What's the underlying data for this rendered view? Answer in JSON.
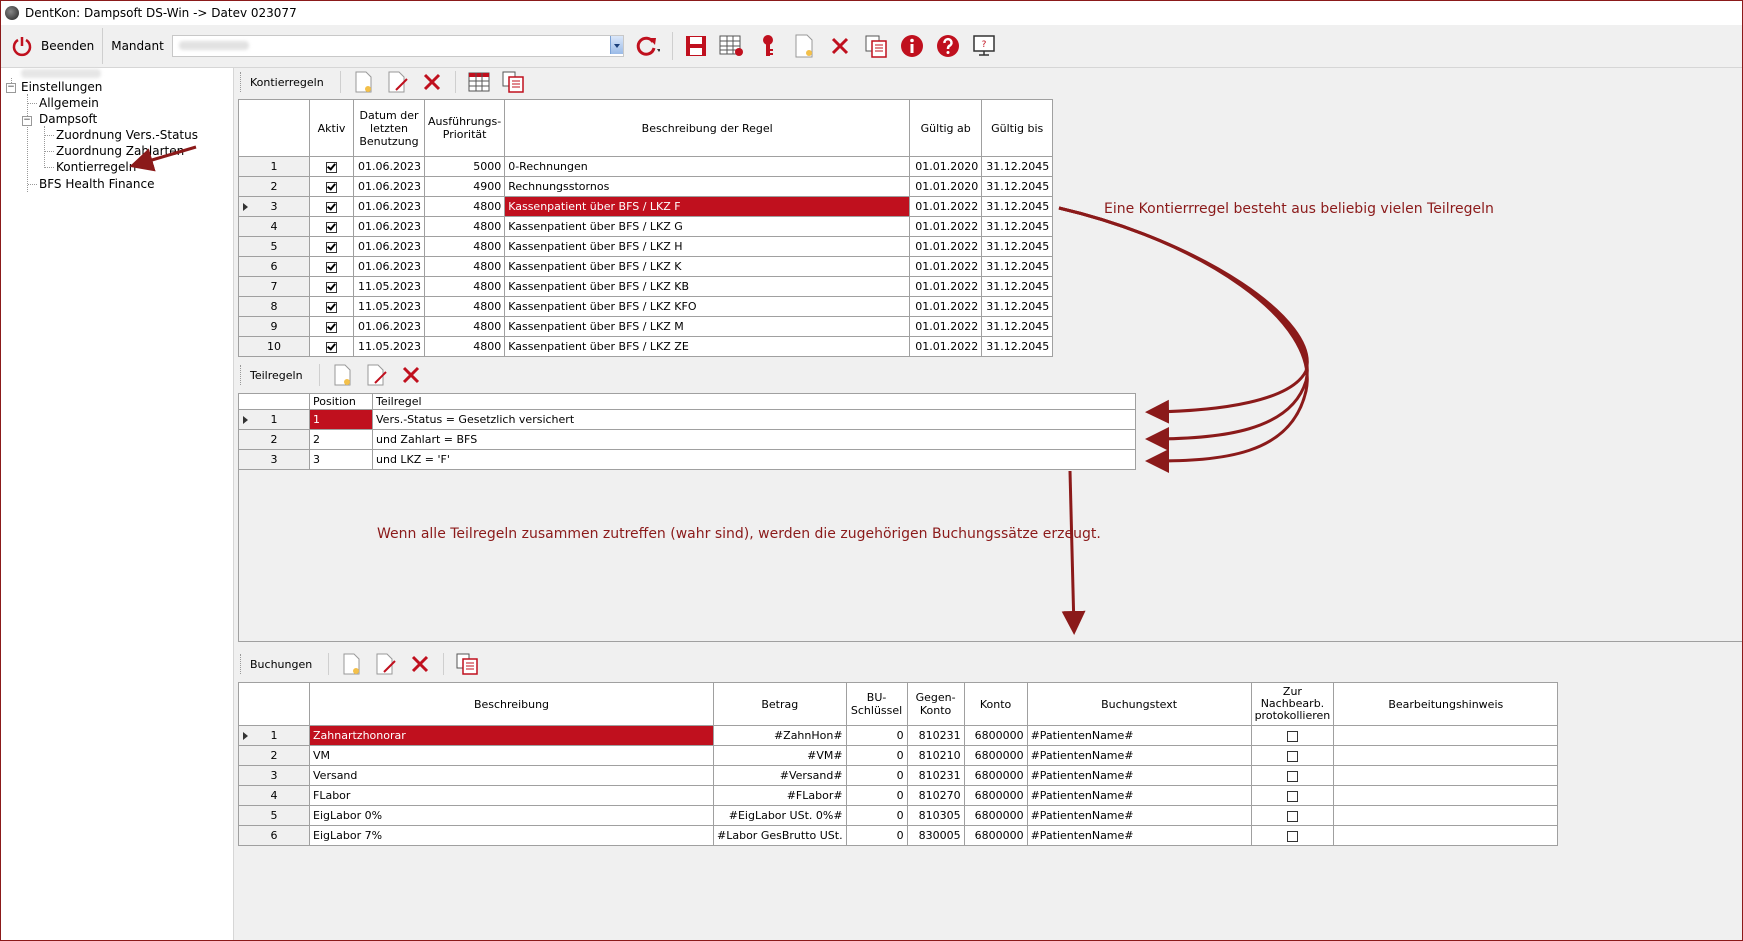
{
  "window": {
    "title": "DentKon: Dampsoft DS-Win -> Datev 023077"
  },
  "toolbar": {
    "beenden_label": "Beenden",
    "mandant_label": "Mandant"
  },
  "tree": {
    "root_label": "Einstellungen",
    "items": {
      "allgemein": "Allgemein",
      "dampsoft": "Dampsoft",
      "vers_status": "Zuordnung Vers.-Status",
      "zahlarten": "Zuordnung Zahlarten",
      "kontierregeln": "Kontierregeln",
      "bfs": "BFS Health Finance"
    }
  },
  "kontierregeln": {
    "label": "Kontierregeln",
    "columns": [
      "Aktiv",
      "Datum der letzten Benutzung",
      "Ausführungs-Priorität",
      "Beschreibung der Regel",
      "Gültig ab",
      "Gültig bis"
    ],
    "rows": [
      {
        "nr": "1",
        "datum": "01.06.2023",
        "prio": "5000",
        "beschreibung": "0-Rechnungen",
        "ab": "01.01.2020",
        "bis": "31.12.2045"
      },
      {
        "nr": "2",
        "datum": "01.06.2023",
        "prio": "4900",
        "beschreibung": "Rechnungsstornos",
        "ab": "01.01.2020",
        "bis": "31.12.2045"
      },
      {
        "nr": "3",
        "datum": "01.06.2023",
        "prio": "4800",
        "beschreibung": "Kassenpatient über BFS / LKZ F",
        "ab": "01.01.2022",
        "bis": "31.12.2045"
      },
      {
        "nr": "4",
        "datum": "01.06.2023",
        "prio": "4800",
        "beschreibung": "Kassenpatient über BFS / LKZ G",
        "ab": "01.01.2022",
        "bis": "31.12.2045"
      },
      {
        "nr": "5",
        "datum": "01.06.2023",
        "prio": "4800",
        "beschreibung": "Kassenpatient über BFS / LKZ H",
        "ab": "01.01.2022",
        "bis": "31.12.2045"
      },
      {
        "nr": "6",
        "datum": "01.06.2023",
        "prio": "4800",
        "beschreibung": "Kassenpatient über BFS / LKZ K",
        "ab": "01.01.2022",
        "bis": "31.12.2045"
      },
      {
        "nr": "7",
        "datum": "11.05.2023",
        "prio": "4800",
        "beschreibung": "Kassenpatient über BFS / LKZ KB",
        "ab": "01.01.2022",
        "bis": "31.12.2045"
      },
      {
        "nr": "8",
        "datum": "11.05.2023",
        "prio": "4800",
        "beschreibung": "Kassenpatient über BFS / LKZ KFO",
        "ab": "01.01.2022",
        "bis": "31.12.2045"
      },
      {
        "nr": "9",
        "datum": "01.06.2023",
        "prio": "4800",
        "beschreibung": "Kassenpatient über BFS / LKZ M",
        "ab": "01.01.2022",
        "bis": "31.12.2045"
      },
      {
        "nr": "10",
        "datum": "11.05.2023",
        "prio": "4800",
        "beschreibung": "Kassenpatient über BFS / LKZ ZE",
        "ab": "01.01.2022",
        "bis": "31.12.2045"
      }
    ]
  },
  "teilregeln": {
    "label": "Teilregeln",
    "columns": [
      "Position",
      "Teilregel"
    ],
    "rows": [
      {
        "nr": "1",
        "pos": "1",
        "regel": "Vers.-Status = Gesetzlich versichert"
      },
      {
        "nr": "2",
        "pos": "2",
        "regel": "und  Zahlart = BFS"
      },
      {
        "nr": "3",
        "pos": "3",
        "regel": "und  LKZ = 'F'"
      }
    ]
  },
  "buchungen": {
    "label": "Buchungen",
    "columns": [
      "Beschreibung",
      "Betrag",
      "BU-Schlüssel",
      "Gegen-Konto",
      "Konto",
      "Buchungstext",
      "Zur Nachbearb. protokollieren",
      "Bearbeitungshinweis"
    ],
    "rows": [
      {
        "nr": "1",
        "beschreibung": "Zahnartzhonorar",
        "betrag": "#ZahnHon#",
        "bu": "0",
        "gegen": "810231",
        "konto": "6800000",
        "text": "#PatientenName#"
      },
      {
        "nr": "2",
        "beschreibung": "VM",
        "betrag": "#VM#",
        "bu": "0",
        "gegen": "810210",
        "konto": "6800000",
        "text": "#PatientenName#"
      },
      {
        "nr": "3",
        "beschreibung": "Versand",
        "betrag": "#Versand#",
        "bu": "0",
        "gegen": "810231",
        "konto": "6800000",
        "text": "#PatientenName#"
      },
      {
        "nr": "4",
        "beschreibung": "FLabor",
        "betrag": "#FLabor#",
        "bu": "0",
        "gegen": "810270",
        "konto": "6800000",
        "text": "#PatientenName#"
      },
      {
        "nr": "5",
        "beschreibung": "EigLabor 0%",
        "betrag": "#EigLabor USt. 0%#",
        "bu": "0",
        "gegen": "810305",
        "konto": "6800000",
        "text": "#PatientenName#"
      },
      {
        "nr": "6",
        "beschreibung": "EigLabor 7%",
        "betrag": "#Labor GesBrutto USt.",
        "bu": "0",
        "gegen": "830005",
        "konto": "6800000",
        "text": "#PatientenName#"
      }
    ]
  },
  "annotations": {
    "teilregeln_note": "Eine Kontierrregel besteht aus beliebig vielen Teilregeln",
    "buchungen_note": "Wenn alle Teilregeln zusammen zutreffen (wahr sind), werden die zugehörigen Buchungssätze erzeugt."
  },
  "colors": {
    "selection": "#c0101e",
    "annotation": "#8b1a1a"
  }
}
